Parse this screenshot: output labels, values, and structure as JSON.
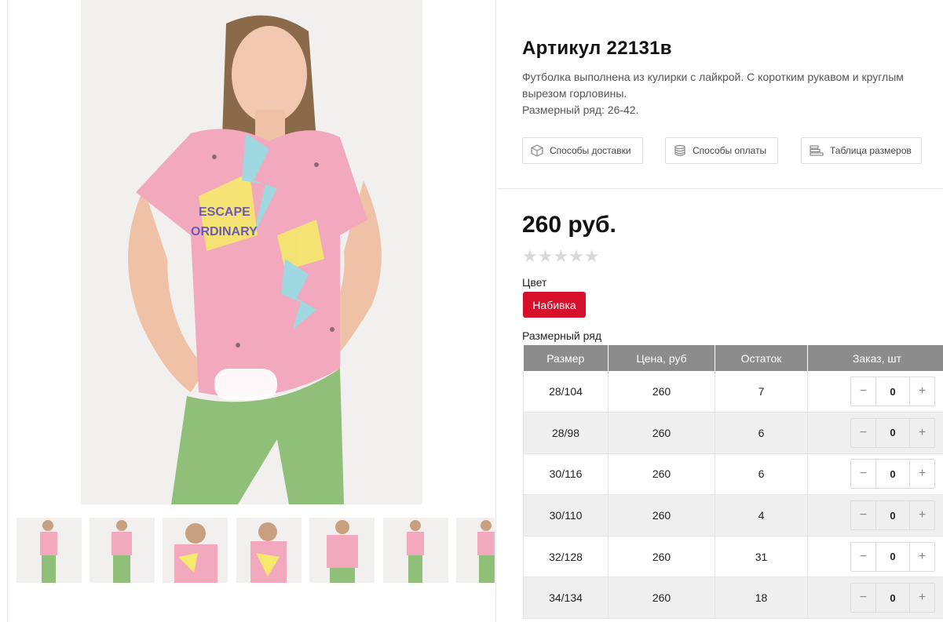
{
  "product": {
    "title": "Артикул 22131в",
    "description_line1": "Футболка выполнена из кулирки с лайкрой. С коротким рукавом и круглым вырезом горловины.",
    "description_line2": "Размерный ряд: 26-42.",
    "price": "260 руб.",
    "rating_stars": "★★★★★",
    "color_label": "Цвет",
    "color_value": "Набивка",
    "size_range_label": "Размерный ряд"
  },
  "links": {
    "delivery": "Способы доставки",
    "payment": "Способы оплаты",
    "size_table": "Таблица размеров"
  },
  "table": {
    "headers": [
      "Размер",
      "Цена, руб",
      "Остаток",
      "Заказ, шт"
    ],
    "rows": [
      {
        "size": "28/104",
        "price": "260",
        "stock": "7",
        "qty": "0"
      },
      {
        "size": "28/98",
        "price": "260",
        "stock": "6",
        "qty": "0"
      },
      {
        "size": "30/116",
        "price": "260",
        "stock": "6",
        "qty": "0"
      },
      {
        "size": "30/110",
        "price": "260",
        "stock": "4",
        "qty": "0"
      },
      {
        "size": "32/128",
        "price": "260",
        "stock": "31",
        "qty": "0"
      },
      {
        "size": "34/134",
        "price": "260",
        "stock": "18",
        "qty": "0"
      }
    ],
    "minus": "−",
    "plus": "+"
  },
  "colors": {
    "accent": "#d6102a",
    "header_bg": "#8c8c8c",
    "shirt_pink": "#f2a9bd",
    "leggings_green": "#8fbf78"
  }
}
